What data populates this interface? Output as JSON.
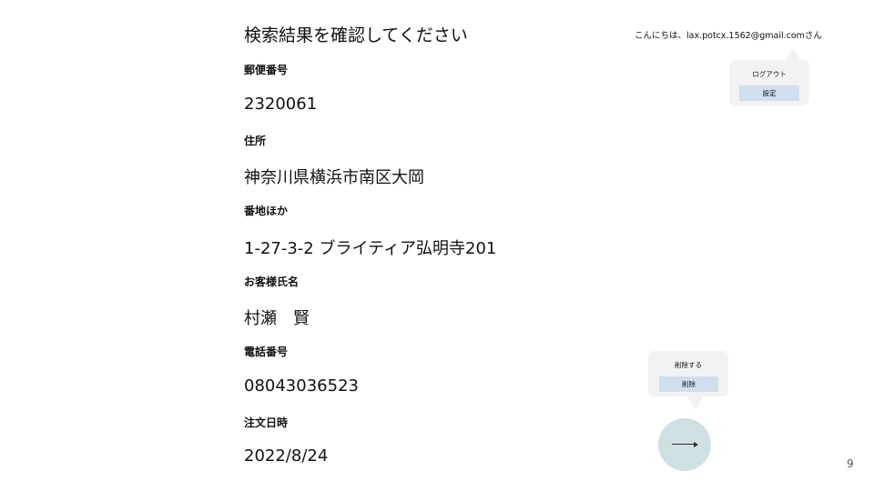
{
  "page": {
    "title": "検索結果を確認してください",
    "page_number": "9"
  },
  "header": {
    "greeting": "こんにちは、lax.potcx.1562@gmail.comさん"
  },
  "account_menu": {
    "logout_label": "ログアウト",
    "settings_button": "設定"
  },
  "delete_menu": {
    "title": "削除する",
    "delete_button": "削除"
  },
  "fields": [
    {
      "label": "郵便番号",
      "value": "2320061"
    },
    {
      "label": "住所",
      "value": "神奈川県横浜市南区大岡"
    },
    {
      "label": "番地ほか",
      "value": "1-27-3-2 ブライティア弘明寺201"
    },
    {
      "label": "お客様氏名",
      "value": "村瀬　賢"
    },
    {
      "label": "電話番号",
      "value": "08043036523"
    },
    {
      "label": "注文日時",
      "value": "2022/8/24"
    }
  ],
  "icons": {
    "fab": "arrow-right-icon"
  }
}
